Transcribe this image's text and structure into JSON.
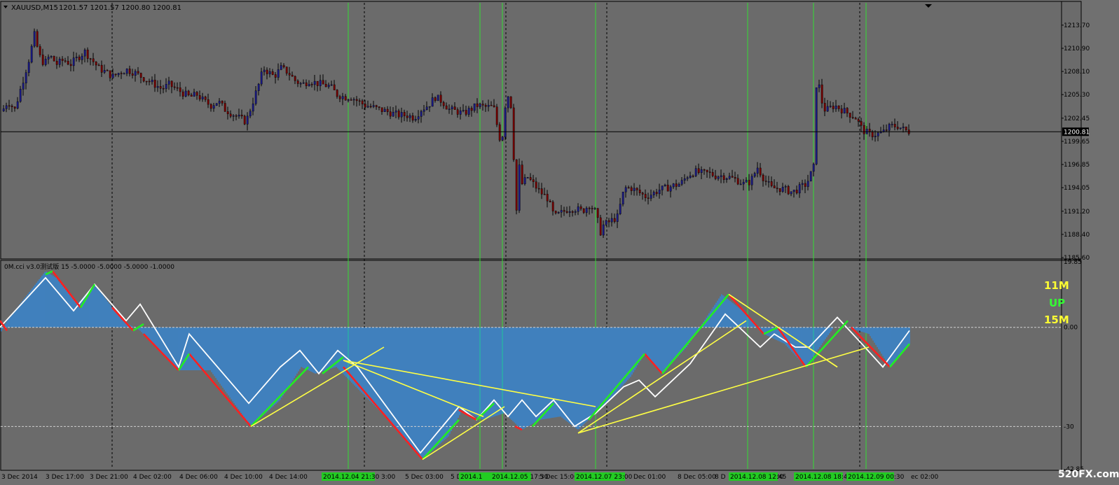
{
  "main_panel": {
    "symbol_label": "XAUUSD,M15",
    "ohlc_label": "1201.57 1201.57 1200.80 1200.81",
    "current_price_label": "1200.81"
  },
  "indicator_panel": {
    "title": "0M.cci v3.0测试版 15 -5.0000 -5.0000 -5.0000 -1.0000",
    "signal_labels": [
      {
        "text": "11M",
        "color": "#ffff33"
      },
      {
        "text": "UP",
        "color": "#33ff33"
      },
      {
        "text": "15M",
        "color": "#ffff33"
      }
    ],
    "zero_label": "0.00",
    "level_label": "-30"
  },
  "time_axis": {
    "labels": [
      "3 Dec 2014",
      "3 Dec 17:00",
      "3 Dec 21:00",
      "4 Dec 02:00",
      "4 Dec 06:00",
      "4 Dec 10:00",
      "4 Dec 14:00",
      "4 De",
      "3:00",
      "5 Dec 03:00",
      "5 D",
      "5 Dec 15:00",
      "Dec 01:00",
      "8 Dec 05:00",
      "8 D",
      ":00",
      "ec 02:00"
    ],
    "highlight_labels": [
      "2014.12.04 21:30",
      "2014.1",
      "2014.12.05 17:30",
      "2014.12.07 23:00",
      "2014.12.08 12:45",
      "2014.12.08 18:45",
      "2014.12.09 00:30"
    ]
  },
  "watermark": "520FX.com",
  "chart_data": [
    {
      "type": "candlestick",
      "title": "XAUUSD,M15",
      "ylim": [
        1185.6,
        1216.4
      ],
      "yticks": [
        1213.7,
        1210.9,
        1208.1,
        1205.3,
        1202.45,
        1199.65,
        1196.85,
        1194.05,
        1191.2,
        1188.4,
        1185.6
      ],
      "last_price": 1200.81,
      "close_path": {
        "x": [
          0,
          10,
          20,
          30,
          40,
          48,
          55,
          62,
          70,
          80,
          90,
          100,
          110,
          120,
          130,
          140,
          150,
          160,
          170,
          180,
          190,
          200,
          210,
          220,
          230,
          240,
          250,
          260,
          270,
          280,
          290,
          300,
          310,
          320,
          330,
          340,
          350,
          360,
          368,
          375,
          382,
          390,
          400,
          410,
          420,
          430,
          440,
          450,
          460,
          470,
          480,
          490,
          500,
          510,
          520,
          530,
          540,
          550,
          560,
          570,
          580,
          590,
          600,
          610,
          620,
          630,
          640,
          650,
          660,
          670,
          680,
          690,
          700,
          705,
          710,
          715,
          720,
          725,
          730,
          735,
          740,
          745,
          750,
          760,
          770,
          780,
          790,
          800,
          810,
          820,
          830,
          840,
          850,
          855,
          860,
          870,
          880,
          890,
          900,
          910,
          920,
          930,
          940,
          950,
          960,
          970,
          980,
          990,
          1000,
          1010,
          1020,
          1030,
          1040,
          1050,
          1060,
          1070,
          1080,
          1090,
          1100,
          1110,
          1120,
          1130,
          1140,
          1150,
          1160,
          1163,
          1166,
          1170,
          1175,
          1180,
          1190,
          1200,
          1210,
          1220,
          1230,
          1240,
          1250,
          1260,
          1270,
          1280,
          1290,
          1298
        ],
        "y": [
          1203.0,
          1204.5,
          1203.5,
          1206.5,
          1209.5,
          1212.5,
          1210.0,
          1209.0,
          1210.0,
          1209.0,
          1209.5,
          1209.0,
          1209.8,
          1210.5,
          1209.5,
          1208.5,
          1208.0,
          1207.5,
          1208.0,
          1208.3,
          1208.0,
          1207.5,
          1207.0,
          1206.5,
          1206.0,
          1206.5,
          1206.0,
          1205.5,
          1205.0,
          1205.3,
          1204.5,
          1204.0,
          1204.5,
          1203.5,
          1203.0,
          1202.5,
          1202.0,
          1204.5,
          1206.5,
          1208.5,
          1208.0,
          1207.5,
          1208.5,
          1208.0,
          1207.0,
          1206.5,
          1207.0,
          1206.7,
          1206.5,
          1206.3,
          1205.3,
          1205.0,
          1205.0,
          1204.5,
          1204.0,
          1203.8,
          1203.5,
          1203.3,
          1203.0,
          1202.8,
          1202.8,
          1202.5,
          1203.5,
          1204.0,
          1205.0,
          1204.5,
          1203.5,
          1203.3,
          1203.0,
          1203.5,
          1204.0,
          1203.8,
          1203.8,
          1203.5,
          1200.5,
          1199.5,
          1204.0,
          1205.5,
          1203.0,
          1190.0,
          1196.5,
          1194.0,
          1195.5,
          1194.5,
          1193.5,
          1192.8,
          1190.5,
          1191.0,
          1191.5,
          1191.5,
          1191.2,
          1192.0,
          1191.0,
          1188.5,
          1189.5,
          1190.0,
          1190.5,
          1194.0,
          1194.0,
          1193.5,
          1193.0,
          1193.3,
          1193.8,
          1194.0,
          1194.3,
          1194.5,
          1195.5,
          1196.0,
          1195.8,
          1195.8,
          1195.5,
          1195.5,
          1195.3,
          1195.0,
          1194.5,
          1194.8,
          1196.5,
          1195.0,
          1194.0,
          1194.0,
          1193.8,
          1193.5,
          1194.0,
          1194.5,
          1196.5,
          1206.0,
          1207.5,
          1205.0,
          1203.5,
          1203.5,
          1204.0,
          1203.5,
          1203.0,
          1202.5,
          1201.0,
          1200.5,
          1200.5,
          1200.8,
          1201.5,
          1201.5,
          1201.0,
          1200.81
        ]
      },
      "green_vlines_x": [
        497,
        685,
        717,
        850,
        1067,
        1161,
        1236
      ],
      "dotted_vlines_x": [
        160,
        520,
        722,
        866,
        1227
      ]
    },
    {
      "type": "line",
      "title": "0M.cci v3.0测试版 15",
      "ylim": [
        -42.85,
        19.85
      ],
      "yticks": [
        19.85,
        0.0,
        -30,
        -42.85
      ],
      "levels": [
        0,
        -30
      ],
      "histogram": {
        "x": [
          0,
          10,
          65,
          80,
          110,
          135,
          175,
          200,
          255,
          300,
          358,
          400,
          430,
          450,
          480,
          550,
          603,
          640,
          660,
          690,
          720,
          745,
          770,
          800,
          825,
          840,
          870,
          900,
          920,
          945,
          980,
          1030,
          1060,
          1090,
          1120,
          1150,
          1190,
          1210,
          1240,
          1270,
          1298
        ],
        "y": [
          -2.0,
          2.0,
          17.0,
          15.0,
          7.0,
          13.0,
          2.0,
          -1.0,
          -13.0,
          -13.0,
          -30.0,
          -22.0,
          -12.0,
          -14.0,
          -12.0,
          -27.0,
          -40.0,
          -33.0,
          -25.0,
          -28.0,
          -26.0,
          -31.0,
          -28.0,
          -27.0,
          -31.0,
          -28.0,
          -22.0,
          -15.0,
          -8.0,
          -14.0,
          -6.0,
          10.0,
          5.0,
          -2.0,
          -5.0,
          -12.0,
          0.0,
          0.0,
          -2.0,
          -12.0,
          -5.0
        ]
      },
      "series": [
        {
          "color": "#ffffff",
          "x": [
            0,
            65,
            105,
            135,
            180,
            200,
            255,
            270,
            355,
            400,
            428,
            455,
            482,
            510,
            600,
            655,
            680,
            705,
            725,
            745,
            765,
            790,
            820,
            850,
            890,
            912,
            935,
            985,
            1035,
            1060,
            1085,
            1105,
            1135,
            1155,
            1195,
            1230,
            1260,
            1298
          ],
          "y": [
            0.0,
            15.0,
            5.0,
            13.0,
            2.0,
            7.0,
            -12.0,
            -2.0,
            -23.0,
            -12.0,
            -7.0,
            -14.0,
            -7.0,
            -12.0,
            -38.0,
            -24.0,
            -28.0,
            -22.0,
            -27.0,
            -22.0,
            -27.0,
            -22.0,
            -30.0,
            -26.0,
            -18.0,
            -16.0,
            -21.0,
            -11.0,
            4.0,
            -1.0,
            -6.0,
            -2.0,
            -6.0,
            -6.0,
            3.0,
            -5.0,
            -12.0,
            -1.0
          ]
        },
        {
          "color": "#ff2020",
          "segments": [
            {
              "x": [
                0,
                10
              ],
              "y": [
                2.0,
                -1.0
              ]
            },
            {
              "x": [
                75,
                115
              ],
              "y": [
                17.0,
                6.0
              ]
            },
            {
              "x": [
                160,
                190
              ],
              "y": [
                6.0,
                -1.0
              ]
            },
            {
              "x": [
                205,
                255
              ],
              "y": [
                -2.0,
                -13.0
              ]
            },
            {
              "x": [
                270,
                358
              ],
              "y": [
                -8.0,
                -30.0
              ]
            },
            {
              "x": [
                490,
                603
              ],
              "y": [
                -12.0,
                -40.0
              ]
            },
            {
              "x": [
                655,
                680
              ],
              "y": [
                -25.0,
                -28.0
              ]
            },
            {
              "x": [
                735,
                745
              ],
              "y": [
                -30.0,
                -31.0
              ]
            },
            {
              "x": [
                920,
                945
              ],
              "y": [
                -8.0,
                -14.0
              ]
            },
            {
              "x": [
                1040,
                1090
              ],
              "y": [
                10.0,
                -2.0
              ]
            },
            {
              "x": [
                1110,
                1150
              ],
              "y": [
                0.0,
                -12.0
              ]
            },
            {
              "x": [
                1215,
                1270
              ],
              "y": [
                0.0,
                -12.0
              ]
            }
          ]
        },
        {
          "color": "#22ee22",
          "segments": [
            {
              "x": [
                65,
                75
              ],
              "y": [
                16.0,
                17.0
              ]
            },
            {
              "x": [
                115,
                135
              ],
              "y": [
                6.0,
                13.0
              ]
            },
            {
              "x": [
                190,
                205
              ],
              "y": [
                -1.0,
                1.0
              ]
            },
            {
              "x": [
                255,
                270
              ],
              "y": [
                -13.0,
                -8.0
              ]
            },
            {
              "x": [
                358,
                440
              ],
              "y": [
                -30.0,
                -12.0
              ]
            },
            {
              "x": [
                460,
                490
              ],
              "y": [
                -14.0,
                -9.0
              ]
            },
            {
              "x": [
                603,
                655
              ],
              "y": [
                -40.0,
                -28.0
              ]
            },
            {
              "x": [
                680,
                705
              ],
              "y": [
                -28.0,
                -23.0
              ]
            },
            {
              "x": [
                760,
                790
              ],
              "y": [
                -30.0,
                -23.0
              ]
            },
            {
              "x": [
                840,
                920
              ],
              "y": [
                -28.0,
                -8.0
              ]
            },
            {
              "x": [
                945,
                1040
              ],
              "y": [
                -14.0,
                10.0
              ]
            },
            {
              "x": [
                1090,
                1110
              ],
              "y": [
                -2.0,
                0.0
              ]
            },
            {
              "x": [
                1150,
                1210
              ],
              "y": [
                -12.0,
                2.0
              ]
            },
            {
              "x": [
                1270,
                1298
              ],
              "y": [
                -12.0,
                -5.0
              ]
            }
          ]
        },
        {
          "color": "#ffff44",
          "segments": [
            {
              "x": [
                358,
                548
              ],
              "y": [
                -30.0,
                -6.0
              ]
            },
            {
              "x": [
                490,
                850
              ],
              "y": [
                -10.0,
                -24.0
              ]
            },
            {
              "x": [
                490,
                690
              ],
              "y": [
                -10.0,
                -27.0
              ]
            },
            {
              "x": [
                603,
                720
              ],
              "y": [
                -40.0,
                -24.0
              ]
            },
            {
              "x": [
                825,
                1065
              ],
              "y": [
                -32.0,
                2.0
              ]
            },
            {
              "x": [
                825,
                1240
              ],
              "y": [
                -32.0,
                -6.0
              ]
            },
            {
              "x": [
                1040,
                1195
              ],
              "y": [
                10.0,
                -12.0
              ]
            },
            {
              "x": [
                1040,
                1195
              ],
              "y": [
                10.0,
                -12.0
              ]
            }
          ]
        }
      ]
    }
  ]
}
